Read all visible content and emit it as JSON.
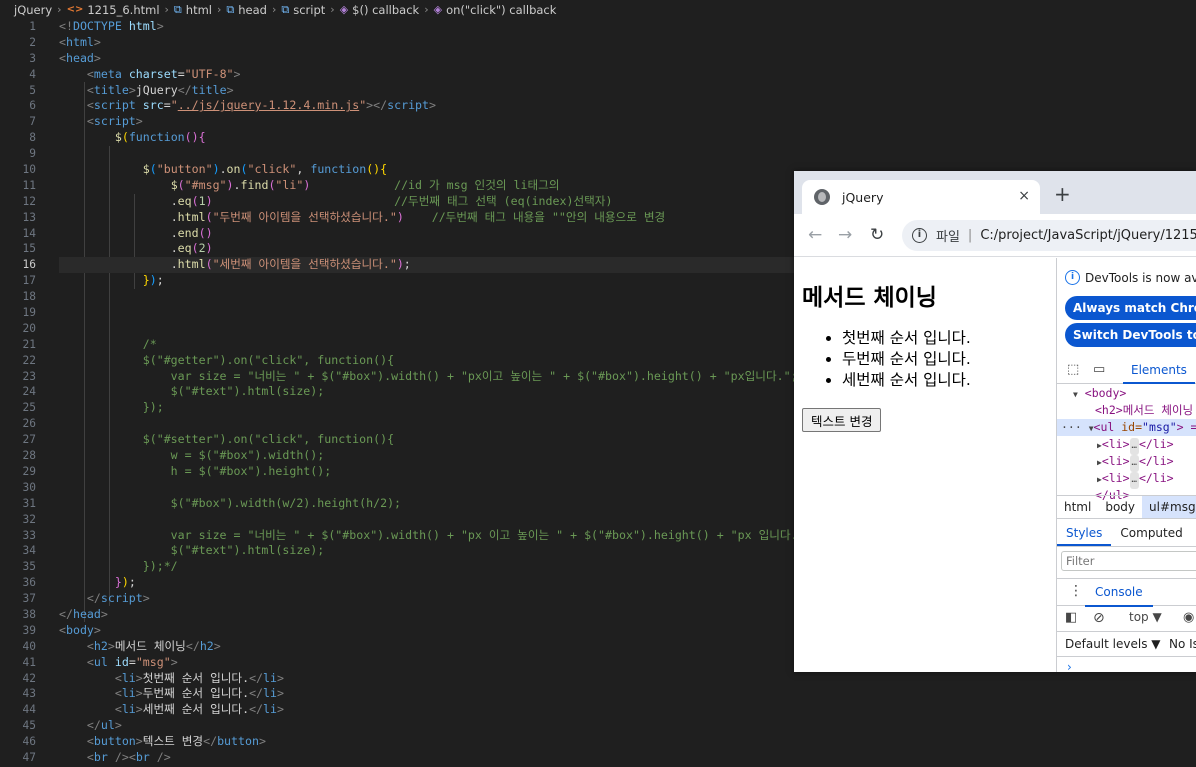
{
  "breadcrumb": {
    "items": [
      "jQuery",
      "1215_6.html",
      "html",
      "head",
      "script",
      "$() callback",
      "on(\"click\") callback"
    ]
  },
  "editor": {
    "active_line": 16,
    "line_numbers": [
      "1",
      "2",
      "3",
      "4",
      "5",
      "6",
      "7",
      "8",
      "9",
      "10",
      "11",
      "12",
      "13",
      "14",
      "15",
      "16",
      "17",
      "18",
      "19",
      "20",
      "21",
      "22",
      "23",
      "24",
      "25",
      "26",
      "27",
      "28",
      "29",
      "30",
      "31",
      "32",
      "33",
      "34",
      "35",
      "36",
      "37",
      "38",
      "39",
      "40",
      "41",
      "42",
      "43",
      "44",
      "45",
      "46",
      "47"
    ],
    "code": {
      "l1_a": "<!",
      "l1_b": "DOCTYPE",
      "l1_c": " html",
      "l1_d": ">",
      "l4_str": "\"UTF-8\"",
      "l5_text": "jQuery",
      "l6_src": "../js/jquery-1.12.4.min.js",
      "l10_sel": "\"button\"",
      "l10_evt": "\"click\"",
      "l11_sel": "\"#msg\"",
      "l11_li": "\"li\"",
      "l11_com": "//id 가 msg 인것의 li태그의",
      "l12_num": "1",
      "l12_com": "//두번째 태그 선택 (eq(index)선택자)",
      "l13_str": "\"두번째 아이템을 선택하셨습니다.\"",
      "l13_com": "//두번째 태그 내용을 \"\"안의 내용으로 변경",
      "l15_num": "2",
      "l16_str": "\"세번째 아이템을 선택하셨습니다.\"",
      "l21": "/*",
      "l22": "$(\"#getter\").on(\"click\", function(){",
      "l23": "    var size = \"너비는 \" + $(\"#box\").width() + \"px이고 높이는 \" + $(\"#box\").height() + \"px입니다.\";",
      "l24": "    $(\"#text\").html(size);",
      "l25": "});",
      "l27": "$(\"#setter\").on(\"click\", function(){",
      "l28": "    w = $(\"#box\").width();",
      "l29": "    h = $(\"#box\").height();",
      "l31": "    $(\"#box\").width(w/2).height(h/2);",
      "l33": "    var size = \"너비는 \" + $(\"#box\").width() + \"px 이고 높이는 \" + $(\"#box\").height() + \"px 입니다.\";",
      "l34": "    $(\"#text\").html(size);",
      "l35": "});*/",
      "l40_text": "메서드 체이닝",
      "l41_val": "\"msg\"",
      "l42_text": "첫번째 순서 입니다.",
      "l43_text": "두번째 순서 입니다.",
      "l44_text": "세번째 순서 입니다.",
      "l46_text": "텍스트 변경"
    }
  },
  "browser": {
    "tab_title": "jQuery",
    "close_glyph": "×",
    "newtab_glyph": "+",
    "back_glyph": "←",
    "forward_glyph": "→",
    "reload_glyph": "↻",
    "info_glyph": "i",
    "url_scheme": "파일",
    "url_sep": "|",
    "url": "C:/project/JavaScript/jQuery/1215_",
    "page": {
      "heading": "메서드 체이닝",
      "items": [
        "첫번째 순서 입니다.",
        "두번째 순서 입니다.",
        "세번째 순서 입니다."
      ],
      "button": "텍스트 변경"
    },
    "devtools": {
      "notice": "DevTools is now avai",
      "pill1": "Always match Chrome's",
      "pill2": "Switch DevTools to Kore",
      "elements_tab": "Elements",
      "dom": {
        "body": "<body>",
        "h2": "<h2>메서드 체이닝",
        "ul_tag": "<ul ",
        "ul_attr": "id=",
        "ul_val": "\"msg\"",
        "ul_end": "> ==",
        "li_open": "<li>",
        "li_close": "</li>",
        "ul_close": "</ul>",
        "dots": "…",
        "tri_down": "▼",
        "tri_right": "▶"
      },
      "crumbs": [
        "html",
        "body",
        "ul#msg"
      ],
      "subtabs": [
        "Styles",
        "Computed",
        "L"
      ],
      "filter": "Filter",
      "console_label": "Console",
      "kebab": "⋮",
      "context": "top ▼",
      "levels": "Default levels ▼",
      "no_issues": "No Is",
      "prompt": "›"
    }
  }
}
